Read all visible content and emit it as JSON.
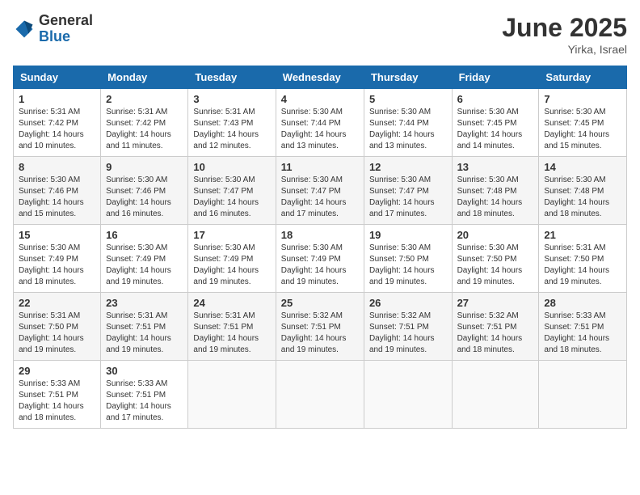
{
  "logo": {
    "general": "General",
    "blue": "Blue"
  },
  "title": {
    "month_year": "June 2025",
    "location": "Yirka, Israel"
  },
  "headers": [
    "Sunday",
    "Monday",
    "Tuesday",
    "Wednesday",
    "Thursday",
    "Friday",
    "Saturday"
  ],
  "weeks": [
    [
      {
        "day": "1",
        "sunrise": "5:31 AM",
        "sunset": "7:42 PM",
        "daylight": "14 hours and 10 minutes."
      },
      {
        "day": "2",
        "sunrise": "5:31 AM",
        "sunset": "7:42 PM",
        "daylight": "14 hours and 11 minutes."
      },
      {
        "day": "3",
        "sunrise": "5:31 AM",
        "sunset": "7:43 PM",
        "daylight": "14 hours and 12 minutes."
      },
      {
        "day": "4",
        "sunrise": "5:30 AM",
        "sunset": "7:44 PM",
        "daylight": "14 hours and 13 minutes."
      },
      {
        "day": "5",
        "sunrise": "5:30 AM",
        "sunset": "7:44 PM",
        "daylight": "14 hours and 13 minutes."
      },
      {
        "day": "6",
        "sunrise": "5:30 AM",
        "sunset": "7:45 PM",
        "daylight": "14 hours and 14 minutes."
      },
      {
        "day": "7",
        "sunrise": "5:30 AM",
        "sunset": "7:45 PM",
        "daylight": "14 hours and 15 minutes."
      }
    ],
    [
      {
        "day": "8",
        "sunrise": "5:30 AM",
        "sunset": "7:46 PM",
        "daylight": "14 hours and 15 minutes."
      },
      {
        "day": "9",
        "sunrise": "5:30 AM",
        "sunset": "7:46 PM",
        "daylight": "14 hours and 16 minutes."
      },
      {
        "day": "10",
        "sunrise": "5:30 AM",
        "sunset": "7:47 PM",
        "daylight": "14 hours and 16 minutes."
      },
      {
        "day": "11",
        "sunrise": "5:30 AM",
        "sunset": "7:47 PM",
        "daylight": "14 hours and 17 minutes."
      },
      {
        "day": "12",
        "sunrise": "5:30 AM",
        "sunset": "7:47 PM",
        "daylight": "14 hours and 17 minutes."
      },
      {
        "day": "13",
        "sunrise": "5:30 AM",
        "sunset": "7:48 PM",
        "daylight": "14 hours and 18 minutes."
      },
      {
        "day": "14",
        "sunrise": "5:30 AM",
        "sunset": "7:48 PM",
        "daylight": "14 hours and 18 minutes."
      }
    ],
    [
      {
        "day": "15",
        "sunrise": "5:30 AM",
        "sunset": "7:49 PM",
        "daylight": "14 hours and 18 minutes."
      },
      {
        "day": "16",
        "sunrise": "5:30 AM",
        "sunset": "7:49 PM",
        "daylight": "14 hours and 19 minutes."
      },
      {
        "day": "17",
        "sunrise": "5:30 AM",
        "sunset": "7:49 PM",
        "daylight": "14 hours and 19 minutes."
      },
      {
        "day": "18",
        "sunrise": "5:30 AM",
        "sunset": "7:49 PM",
        "daylight": "14 hours and 19 minutes."
      },
      {
        "day": "19",
        "sunrise": "5:30 AM",
        "sunset": "7:50 PM",
        "daylight": "14 hours and 19 minutes."
      },
      {
        "day": "20",
        "sunrise": "5:30 AM",
        "sunset": "7:50 PM",
        "daylight": "14 hours and 19 minutes."
      },
      {
        "day": "21",
        "sunrise": "5:31 AM",
        "sunset": "7:50 PM",
        "daylight": "14 hours and 19 minutes."
      }
    ],
    [
      {
        "day": "22",
        "sunrise": "5:31 AM",
        "sunset": "7:50 PM",
        "daylight": "14 hours and 19 minutes."
      },
      {
        "day": "23",
        "sunrise": "5:31 AM",
        "sunset": "7:51 PM",
        "daylight": "14 hours and 19 minutes."
      },
      {
        "day": "24",
        "sunrise": "5:31 AM",
        "sunset": "7:51 PM",
        "daylight": "14 hours and 19 minutes."
      },
      {
        "day": "25",
        "sunrise": "5:32 AM",
        "sunset": "7:51 PM",
        "daylight": "14 hours and 19 minutes."
      },
      {
        "day": "26",
        "sunrise": "5:32 AM",
        "sunset": "7:51 PM",
        "daylight": "14 hours and 19 minutes."
      },
      {
        "day": "27",
        "sunrise": "5:32 AM",
        "sunset": "7:51 PM",
        "daylight": "14 hours and 18 minutes."
      },
      {
        "day": "28",
        "sunrise": "5:33 AM",
        "sunset": "7:51 PM",
        "daylight": "14 hours and 18 minutes."
      }
    ],
    [
      {
        "day": "29",
        "sunrise": "5:33 AM",
        "sunset": "7:51 PM",
        "daylight": "14 hours and 18 minutes."
      },
      {
        "day": "30",
        "sunrise": "5:33 AM",
        "sunset": "7:51 PM",
        "daylight": "14 hours and 17 minutes."
      },
      null,
      null,
      null,
      null,
      null
    ]
  ],
  "labels": {
    "sunrise": "Sunrise:",
    "sunset": "Sunset:",
    "daylight": "Daylight: "
  }
}
